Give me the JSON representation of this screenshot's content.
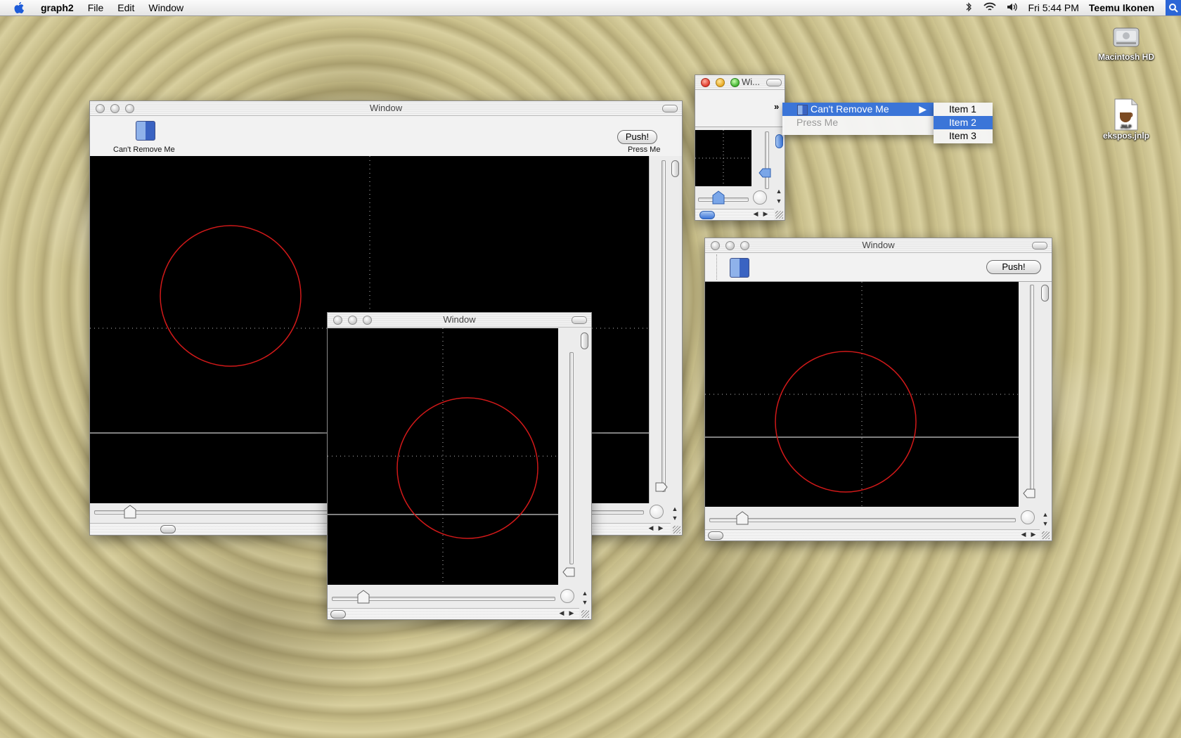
{
  "menubar": {
    "app_name": "graph2",
    "menus": [
      "File",
      "Edit",
      "Window"
    ],
    "clock": "Fri 5:44 PM",
    "user": "Teemu Ikonen"
  },
  "desktop": {
    "icons": [
      {
        "label": "Macintosh HD",
        "icon": "hard-drive-icon"
      },
      {
        "label": "ekspos.jnlp",
        "icon": "jnlp-file-icon"
      }
    ]
  },
  "windows": {
    "main": {
      "title": "Window",
      "toolbar_item_label": "Can't Remove Me",
      "push_label": "Push!",
      "press_label": "Press Me"
    },
    "small": {
      "title": "Wi..."
    },
    "middle": {
      "title": "Window"
    },
    "right": {
      "title": "Window",
      "push_label": "Push!"
    }
  },
  "overflow_menu": {
    "items": [
      {
        "label": "Can't Remove Me",
        "state": "highlighted"
      },
      {
        "label": "Press Me",
        "state": "disabled"
      }
    ],
    "submenu": [
      "Item 1",
      "Item 2",
      "Item 3"
    ],
    "submenu_selected": "Item 2"
  },
  "colors": {
    "accent": "#3b75d8",
    "plot_circle": "#d11919",
    "plot_bg": "#000000"
  }
}
